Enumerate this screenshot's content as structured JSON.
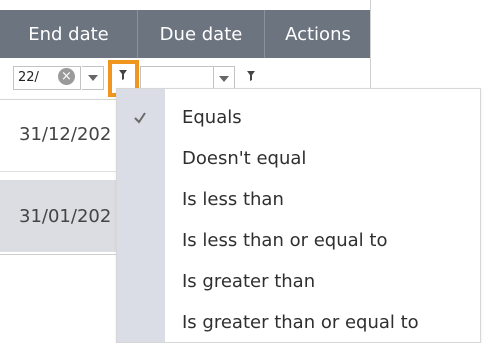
{
  "header": {
    "col_end": "End date",
    "col_due": "Due date",
    "col_actions": "Actions"
  },
  "filters": {
    "end_value": "22/​"
  },
  "rows": [
    {
      "end_date": "31/12/202"
    },
    {
      "end_date": "31/01/202"
    }
  ],
  "menu": {
    "items": [
      {
        "label": "Equals",
        "checked": true
      },
      {
        "label": "Doesn't equal",
        "checked": false
      },
      {
        "label": "Is less than",
        "checked": false
      },
      {
        "label": "Is less than or equal to",
        "checked": false
      },
      {
        "label": "Is greater than",
        "checked": false
      },
      {
        "label": "Is greater than or equal to",
        "checked": false
      }
    ]
  },
  "colors": {
    "header_bg": "#6c7480",
    "highlight": "#f0961e",
    "selected_row": "#dcdde2",
    "menu_gutter": "#dbdde6"
  },
  "icons": [
    "clear-filter-icon",
    "dropdown-arrow-icon",
    "filter-funnel-icon",
    "checkmark-icon"
  ]
}
